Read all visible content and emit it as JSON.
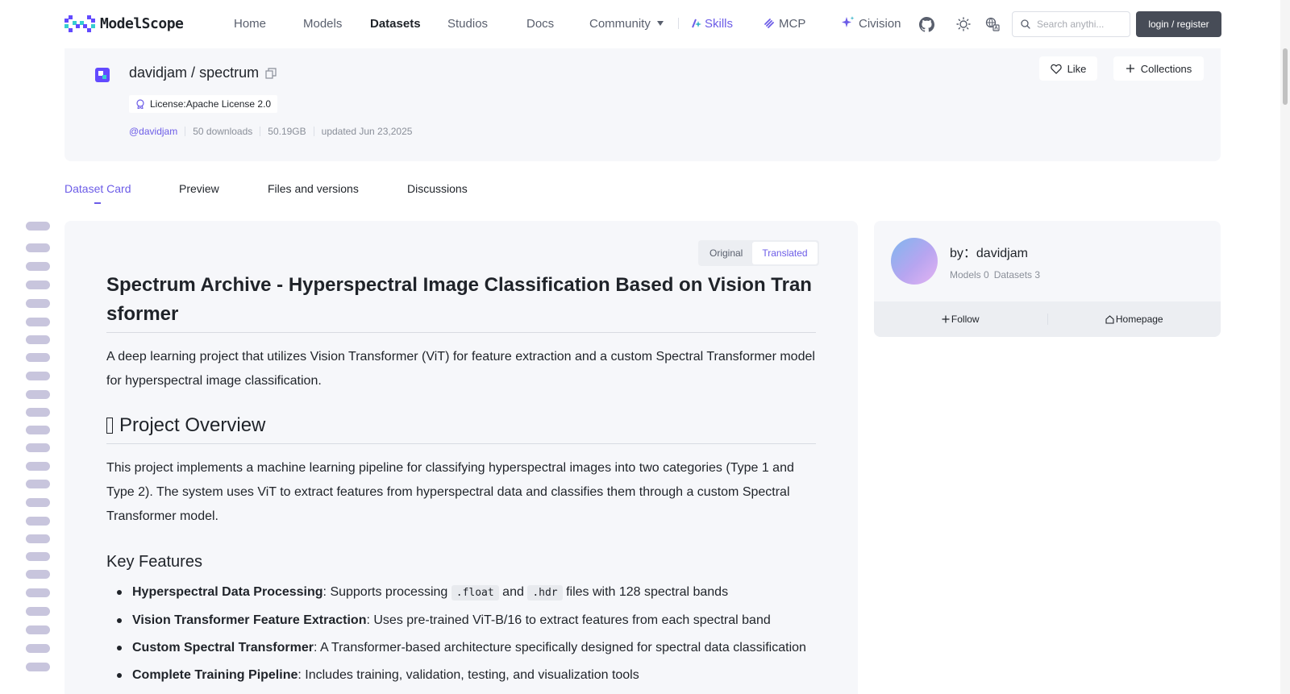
{
  "nav": {
    "logo_text": "ModelScope",
    "items": {
      "home": "Home",
      "models": "Models",
      "datasets": "Datasets",
      "studios": "Studios",
      "docs": "Docs",
      "community": "Community",
      "skills": "Skills",
      "mcp": "MCP",
      "civision": "Civision"
    },
    "search_placeholder": "Search anythi...",
    "login_label": "login / register",
    "accent_color": "#6c5ce7"
  },
  "repo": {
    "owner": "davidjam",
    "name": "spectrum",
    "license": "License:Apache License 2.0",
    "user_handle": "@davidjam",
    "downloads": "50 downloads",
    "size": "50.19GB",
    "updated": "updated Jun 23,2025",
    "like_label": "Like",
    "collections_label": "Collections"
  },
  "tabs": [
    "Dataset Card",
    "Preview",
    "Files and versions",
    "Discussions"
  ],
  "toggle": {
    "original": "Original",
    "translated": "Translated"
  },
  "article": {
    "title": "Spectrum Archive - Hyperspectral Image Classification Based on Vision Transformer",
    "intro": "A deep learning project that utilizes Vision Transformer (ViT) for feature extraction and a custom Spectral Transformer model for hyperspectral image classification.",
    "overview_heading": "Project Overview",
    "overview_text": "This project implements a machine learning pipeline for classifying hyperspectral images into two categories (Type 1 and Type 2). The system uses ViT to extract features from hyperspectral data and classifies them through a custom Spectral Transformer model.",
    "features_heading": "Key Features",
    "features": [
      {
        "title": "Hyperspectral Data Processing",
        "pre": ": Supports processing ",
        "code1": ".float",
        "mid": " and ",
        "code2": ".hdr",
        "post": " files with 128 spectral bands"
      },
      {
        "title": "Vision Transformer Feature Extraction",
        "text": ": Uses pre-trained ViT-B/16 to extract features from each spectral band"
      },
      {
        "title": "Custom Spectral Transformer",
        "text": ": A Transformer-based architecture specifically designed for spectral data classification"
      },
      {
        "title": "Complete Training Pipeline",
        "text": ": Includes training, validation, testing, and visualization tools"
      }
    ]
  },
  "sidebar": {
    "by_label": "by：davidjam",
    "models": "Models 0",
    "datasets": "Datasets 3",
    "follow_label": "Follow",
    "homepage_label": "Homepage"
  }
}
